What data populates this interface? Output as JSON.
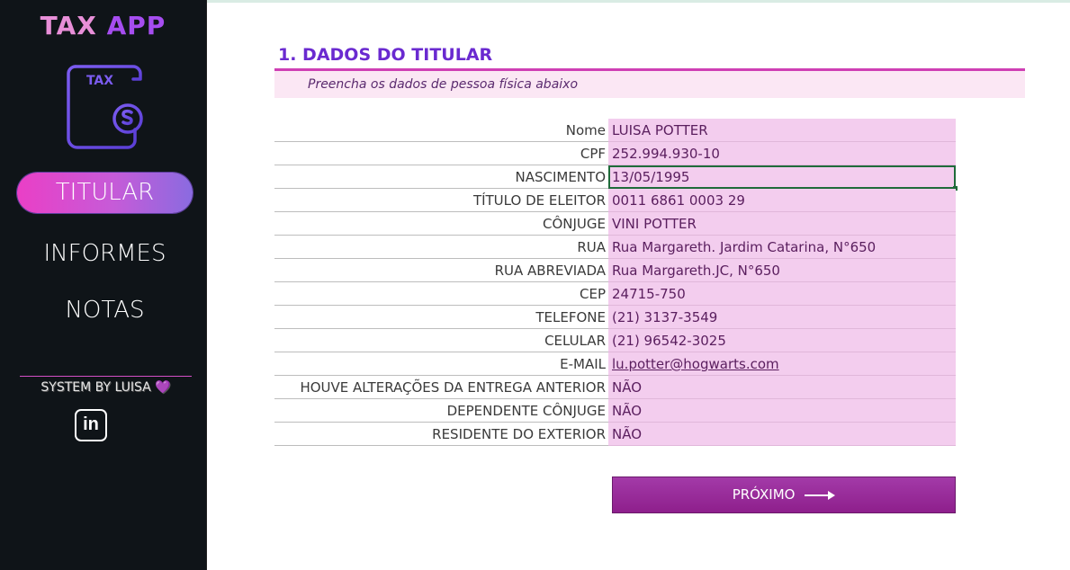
{
  "app": {
    "logo_part1": "TAX",
    "logo_part2": "APP",
    "tax_icon_text": "TAX"
  },
  "sidebar": {
    "items": [
      {
        "label": "TITULAR",
        "active": true
      },
      {
        "label": "INFORMES",
        "active": false
      },
      {
        "label": "NOTAS",
        "active": false
      }
    ],
    "credit": "SYSTEM BY LUISA",
    "credit_emoji": "💜",
    "linkedin_label": "in"
  },
  "section": {
    "title": "1. DADOS DO TITULAR",
    "subtitle": "Preencha os dados de pessoa física abaixo"
  },
  "form": {
    "fields": [
      {
        "label": "Nome",
        "value": "LUISA POTTER"
      },
      {
        "label": "CPF",
        "value": "252.994.930-10"
      },
      {
        "label": "NASCIMENTO",
        "value": "13/05/1995"
      },
      {
        "label": "TÍTULO DE ELEITOR",
        "value": "0011 6861 0003 29"
      },
      {
        "label": "CÔNJUGE",
        "value": "VINI POTTER"
      },
      {
        "label": "RUA",
        "value": "Rua Margareth. Jardim Catarina, N°650"
      },
      {
        "label": "RUA ABREVIADA",
        "value": "Rua Margareth.JC, N°650"
      },
      {
        "label": "CEP",
        "value": "24715-750"
      },
      {
        "label": "TELEFONE",
        "value": "(21) 3137-3549"
      },
      {
        "label": "CELULAR",
        "value": "(21) 96542-3025"
      },
      {
        "label": "E-MAIL",
        "value": "lu.potter@hogwarts.com"
      },
      {
        "label": "HOUVE ALTERAÇÕES DA ENTREGA ANTERIOR",
        "value": "NÃO"
      },
      {
        "label": "DEPENDENTE CÔNJUGE",
        "value": "NÃO"
      },
      {
        "label": "RESIDENTE DO EXTERIOR",
        "value": "NÃO"
      }
    ]
  },
  "next_button": {
    "label": "PRÓXIMO"
  },
  "colors": {
    "sidebar_bg": "#0f1418",
    "accent_pink": "#cf3fb4",
    "title_purple": "#6a2ad0",
    "value_cell_bg": "#f3cdee",
    "button_purple": "#8e1f8c"
  }
}
